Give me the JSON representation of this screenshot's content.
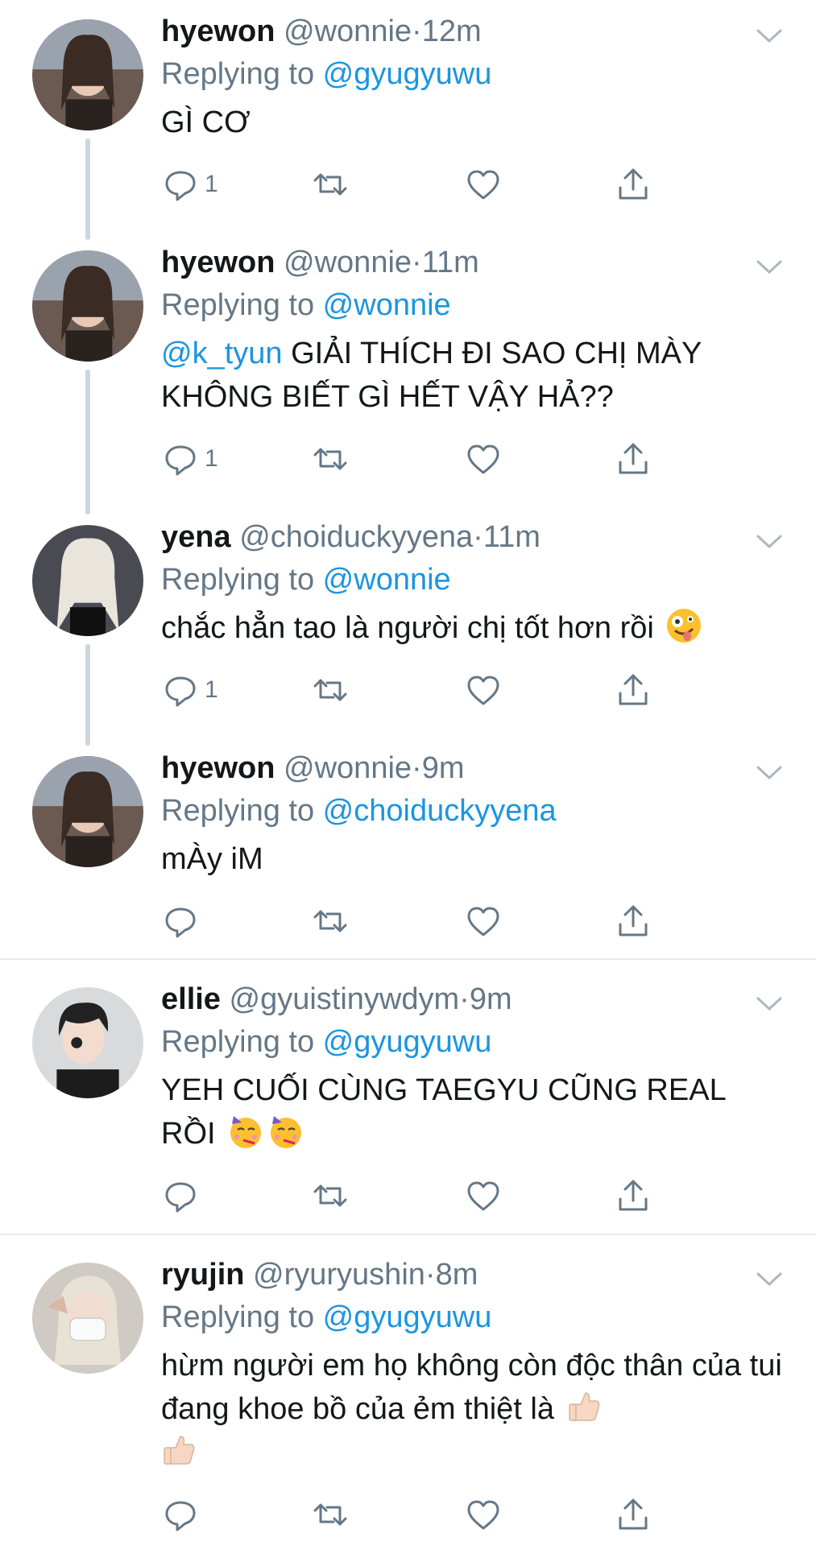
{
  "colors": {
    "link": "#1b95e0",
    "muted": "#657786",
    "text": "#14171a",
    "thread_line": "#ccd6dd"
  },
  "tweets": [
    {
      "name": "hyewon",
      "handle": "@wonnie",
      "dot": "·",
      "time": "12m",
      "replying_prefix": "Replying to ",
      "replying_to": "@gyugyuwu",
      "body": "GÌ CƠ",
      "mention": "",
      "reply_count": "1",
      "emoji": []
    },
    {
      "name": "hyewon",
      "handle": "@wonnie",
      "dot": "·",
      "time": "11m",
      "replying_prefix": "Replying to ",
      "replying_to": "@wonnie",
      "mention": "@k_tyun",
      "body": " GIẢI THÍCH ĐI SAO CHỊ MÀY KHÔNG BIẾT GÌ HẾT VẬY HẢ??",
      "reply_count": "1",
      "emoji": []
    },
    {
      "name": "yena",
      "handle": "@choiduckyyena",
      "dot": "·",
      "time": "11m",
      "replying_prefix": "Replying to ",
      "replying_to": "@wonnie",
      "body": "chắc hẳn tao là người chị tốt hơn rồi",
      "mention": "",
      "reply_count": "1",
      "emoji": [
        "zany-face"
      ]
    },
    {
      "name": "hyewon",
      "handle": "@wonnie",
      "dot": "·",
      "time": "9m",
      "replying_prefix": "Replying to ",
      "replying_to": "@choiduckyyena",
      "body": "mÀy iM",
      "mention": "",
      "reply_count": "",
      "emoji": []
    },
    {
      "name": "ellie",
      "handle": "@gyuistinywdym",
      "dot": "·",
      "time": "9m",
      "replying_prefix": "Replying to ",
      "replying_to": "@gyugyuwu",
      "body": "YEH CUỐI CÙNG TAEGYU CŨNG REAL RỒI",
      "mention": "",
      "reply_count": "",
      "emoji": [
        "partying-face",
        "partying-face"
      ]
    },
    {
      "name": "ryujin",
      "handle": "@ryuryushin",
      "dot": "·",
      "time": "8m",
      "replying_prefix": "Replying to ",
      "replying_to": "@gyugyuwu",
      "body": "hừm người em họ không còn độc thân của tui đang khoe bồ của ẻm thiệt là",
      "mention": "",
      "reply_count": "",
      "emoji": [
        "thumbs-up",
        "thumbs-up"
      ]
    }
  ],
  "icons": [
    "reply-icon",
    "retweet-icon",
    "like-icon",
    "share-icon",
    "chevron-down-icon"
  ]
}
